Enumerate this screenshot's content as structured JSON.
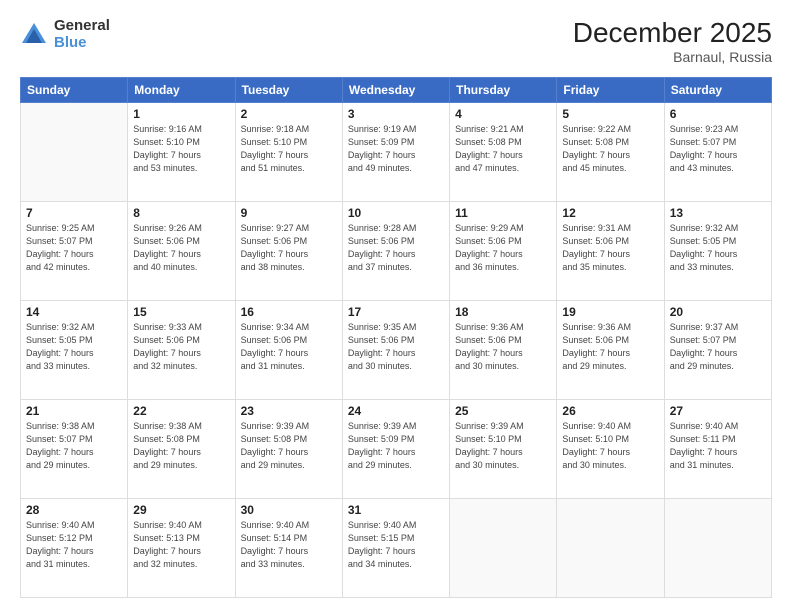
{
  "logo": {
    "general": "General",
    "blue": "Blue"
  },
  "header": {
    "title": "December 2025",
    "subtitle": "Barnaul, Russia"
  },
  "weekdays": [
    "Sunday",
    "Monday",
    "Tuesday",
    "Wednesday",
    "Thursday",
    "Friday",
    "Saturday"
  ],
  "weeks": [
    [
      {
        "day": "",
        "info": ""
      },
      {
        "day": "1",
        "info": "Sunrise: 9:16 AM\nSunset: 5:10 PM\nDaylight: 7 hours\nand 53 minutes."
      },
      {
        "day": "2",
        "info": "Sunrise: 9:18 AM\nSunset: 5:10 PM\nDaylight: 7 hours\nand 51 minutes."
      },
      {
        "day": "3",
        "info": "Sunrise: 9:19 AM\nSunset: 5:09 PM\nDaylight: 7 hours\nand 49 minutes."
      },
      {
        "day": "4",
        "info": "Sunrise: 9:21 AM\nSunset: 5:08 PM\nDaylight: 7 hours\nand 47 minutes."
      },
      {
        "day": "5",
        "info": "Sunrise: 9:22 AM\nSunset: 5:08 PM\nDaylight: 7 hours\nand 45 minutes."
      },
      {
        "day": "6",
        "info": "Sunrise: 9:23 AM\nSunset: 5:07 PM\nDaylight: 7 hours\nand 43 minutes."
      }
    ],
    [
      {
        "day": "7",
        "info": "Sunrise: 9:25 AM\nSunset: 5:07 PM\nDaylight: 7 hours\nand 42 minutes."
      },
      {
        "day": "8",
        "info": "Sunrise: 9:26 AM\nSunset: 5:06 PM\nDaylight: 7 hours\nand 40 minutes."
      },
      {
        "day": "9",
        "info": "Sunrise: 9:27 AM\nSunset: 5:06 PM\nDaylight: 7 hours\nand 38 minutes."
      },
      {
        "day": "10",
        "info": "Sunrise: 9:28 AM\nSunset: 5:06 PM\nDaylight: 7 hours\nand 37 minutes."
      },
      {
        "day": "11",
        "info": "Sunrise: 9:29 AM\nSunset: 5:06 PM\nDaylight: 7 hours\nand 36 minutes."
      },
      {
        "day": "12",
        "info": "Sunrise: 9:31 AM\nSunset: 5:06 PM\nDaylight: 7 hours\nand 35 minutes."
      },
      {
        "day": "13",
        "info": "Sunrise: 9:32 AM\nSunset: 5:05 PM\nDaylight: 7 hours\nand 33 minutes."
      }
    ],
    [
      {
        "day": "14",
        "info": "Sunrise: 9:32 AM\nSunset: 5:05 PM\nDaylight: 7 hours\nand 33 minutes."
      },
      {
        "day": "15",
        "info": "Sunrise: 9:33 AM\nSunset: 5:06 PM\nDaylight: 7 hours\nand 32 minutes."
      },
      {
        "day": "16",
        "info": "Sunrise: 9:34 AM\nSunset: 5:06 PM\nDaylight: 7 hours\nand 31 minutes."
      },
      {
        "day": "17",
        "info": "Sunrise: 9:35 AM\nSunset: 5:06 PM\nDaylight: 7 hours\nand 30 minutes."
      },
      {
        "day": "18",
        "info": "Sunrise: 9:36 AM\nSunset: 5:06 PM\nDaylight: 7 hours\nand 30 minutes."
      },
      {
        "day": "19",
        "info": "Sunrise: 9:36 AM\nSunset: 5:06 PM\nDaylight: 7 hours\nand 29 minutes."
      },
      {
        "day": "20",
        "info": "Sunrise: 9:37 AM\nSunset: 5:07 PM\nDaylight: 7 hours\nand 29 minutes."
      }
    ],
    [
      {
        "day": "21",
        "info": "Sunrise: 9:38 AM\nSunset: 5:07 PM\nDaylight: 7 hours\nand 29 minutes."
      },
      {
        "day": "22",
        "info": "Sunrise: 9:38 AM\nSunset: 5:08 PM\nDaylight: 7 hours\nand 29 minutes."
      },
      {
        "day": "23",
        "info": "Sunrise: 9:39 AM\nSunset: 5:08 PM\nDaylight: 7 hours\nand 29 minutes."
      },
      {
        "day": "24",
        "info": "Sunrise: 9:39 AM\nSunset: 5:09 PM\nDaylight: 7 hours\nand 29 minutes."
      },
      {
        "day": "25",
        "info": "Sunrise: 9:39 AM\nSunset: 5:10 PM\nDaylight: 7 hours\nand 30 minutes."
      },
      {
        "day": "26",
        "info": "Sunrise: 9:40 AM\nSunset: 5:10 PM\nDaylight: 7 hours\nand 30 minutes."
      },
      {
        "day": "27",
        "info": "Sunrise: 9:40 AM\nSunset: 5:11 PM\nDaylight: 7 hours\nand 31 minutes."
      }
    ],
    [
      {
        "day": "28",
        "info": "Sunrise: 9:40 AM\nSunset: 5:12 PM\nDaylight: 7 hours\nand 31 minutes."
      },
      {
        "day": "29",
        "info": "Sunrise: 9:40 AM\nSunset: 5:13 PM\nDaylight: 7 hours\nand 32 minutes."
      },
      {
        "day": "30",
        "info": "Sunrise: 9:40 AM\nSunset: 5:14 PM\nDaylight: 7 hours\nand 33 minutes."
      },
      {
        "day": "31",
        "info": "Sunrise: 9:40 AM\nSunset: 5:15 PM\nDaylight: 7 hours\nand 34 minutes."
      },
      {
        "day": "",
        "info": ""
      },
      {
        "day": "",
        "info": ""
      },
      {
        "day": "",
        "info": ""
      }
    ]
  ]
}
